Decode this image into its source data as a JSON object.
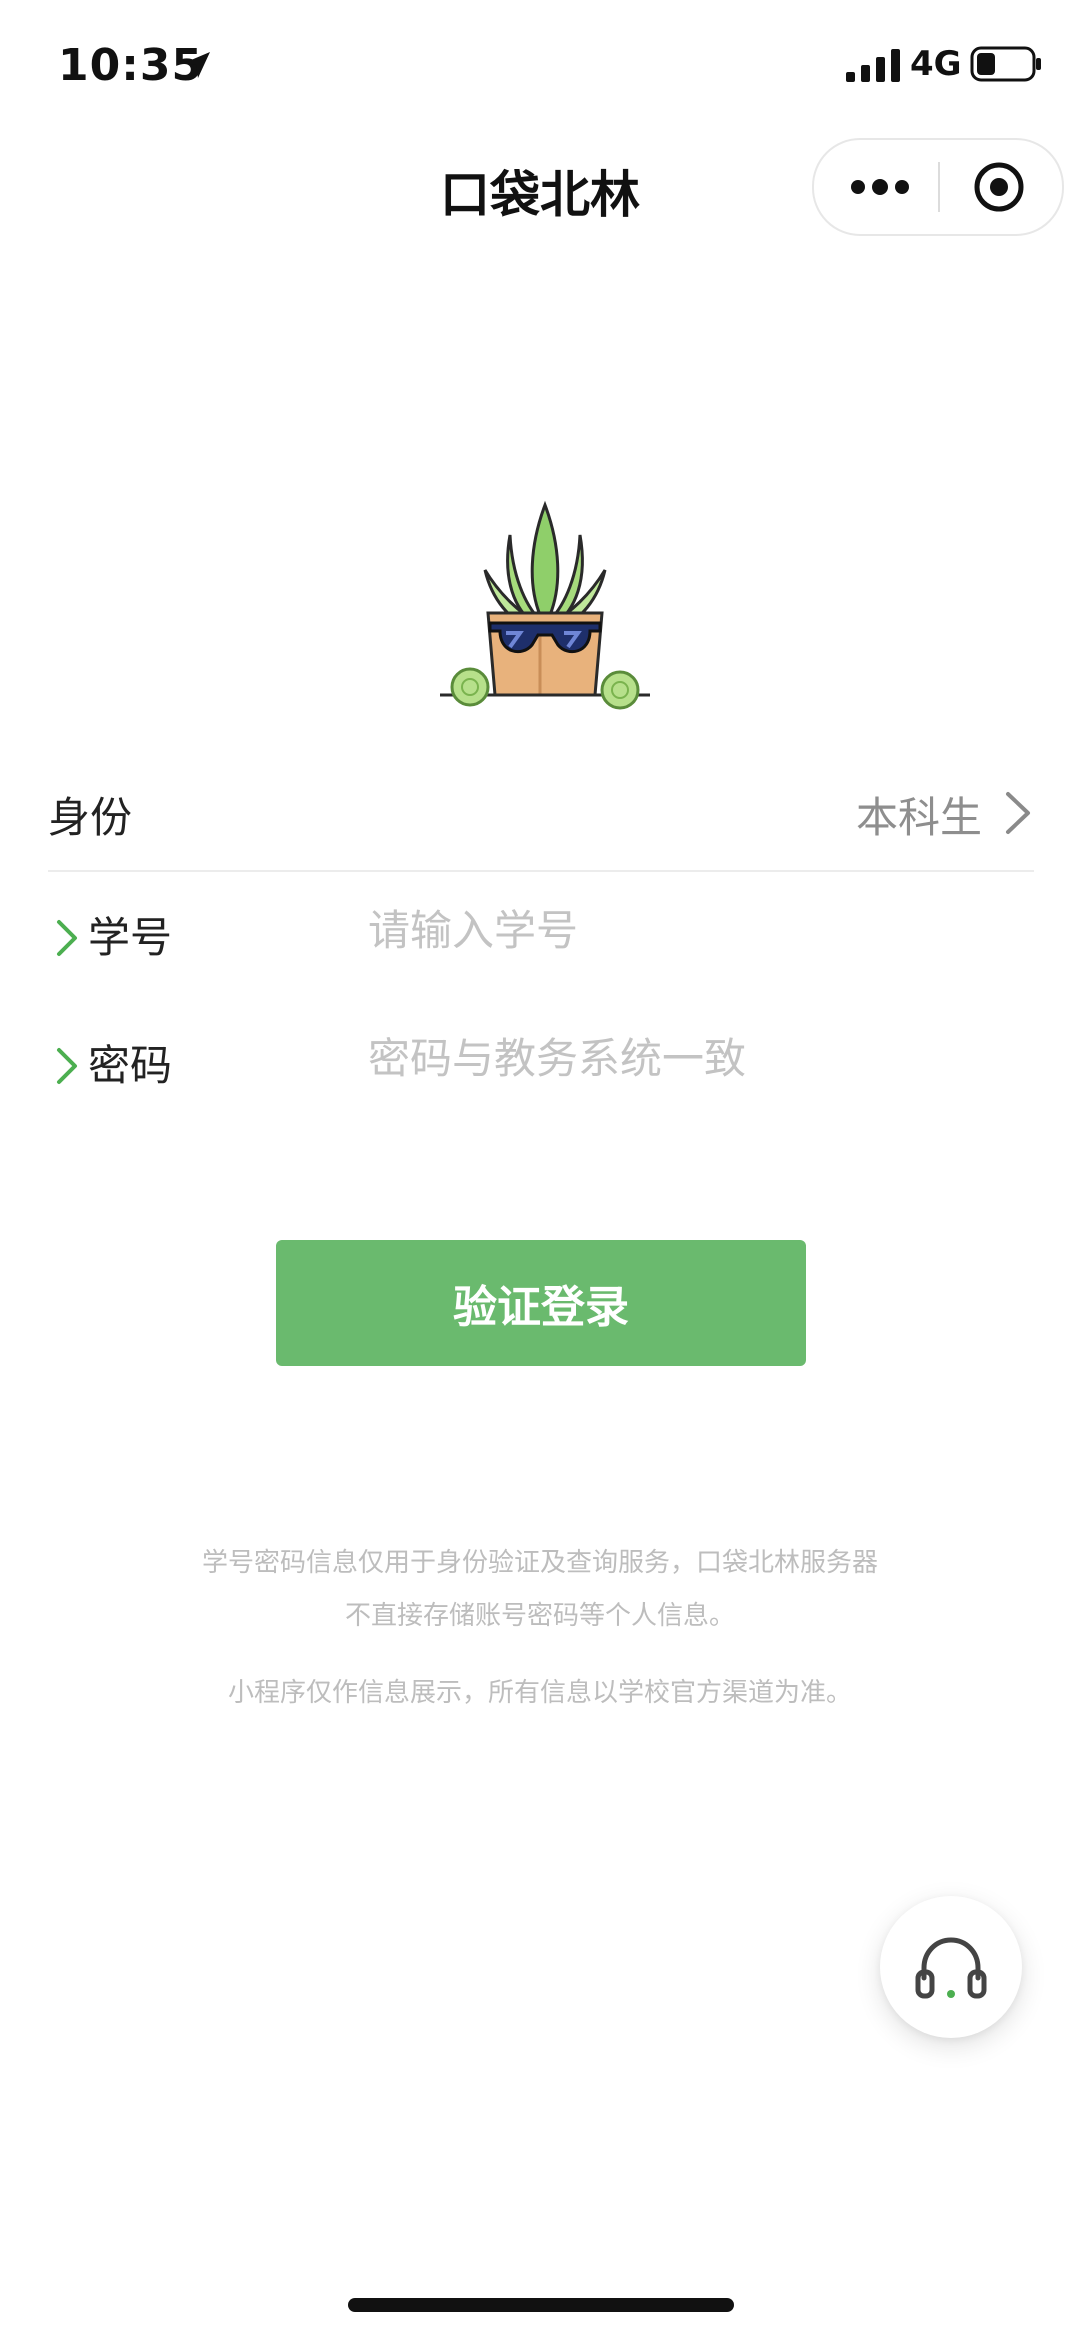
{
  "status_bar": {
    "time": "10:35",
    "network": "4G",
    "icons": [
      "location-arrow-icon",
      "signal-icon",
      "battery-icon"
    ]
  },
  "nav": {
    "title": "口袋北林",
    "icons": [
      "more-icon",
      "close-target-icon"
    ]
  },
  "form": {
    "identity": {
      "label": "身份",
      "value": "本科生"
    },
    "student_id": {
      "label": "学号",
      "placeholder": "请输入学号",
      "value": ""
    },
    "password": {
      "label": "密码",
      "placeholder": "密码与教务系统一致",
      "value": ""
    }
  },
  "login_button": {
    "label": "验证登录"
  },
  "notes": {
    "line1": "学号密码信息仅用于身份验证及查询服务，口袋北林服务器",
    "line2": "不直接存储账号密码等个人信息。",
    "line3": "小程序仅作信息展示，所有信息以学校官方渠道为准。"
  },
  "support": {
    "icon": "headset-icon"
  },
  "colors": {
    "accent": "#6aba6e",
    "placeholder": "#c3c3c3",
    "note_text": "#bdbdbd"
  }
}
